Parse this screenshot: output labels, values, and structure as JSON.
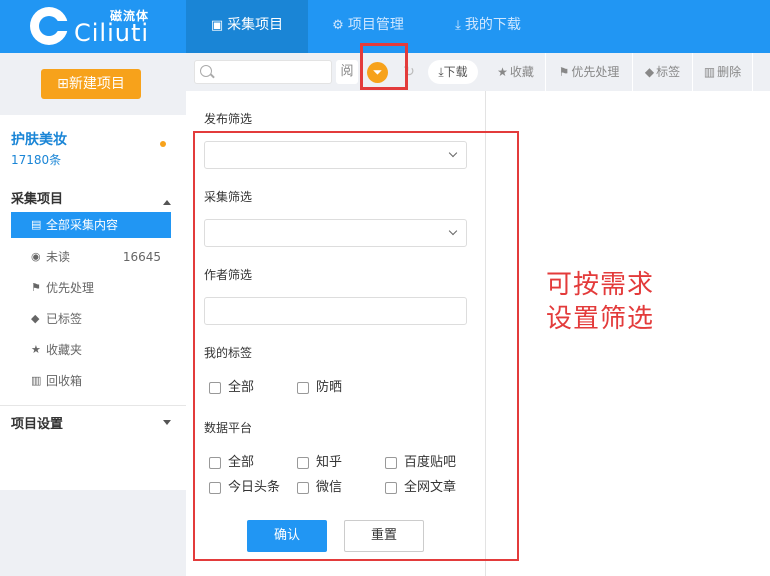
{
  "header": {
    "logo_cn": "磁流体",
    "logo_en": "Ciliuti",
    "tabs": [
      {
        "label": "采集项目",
        "icon": "save-icon",
        "active": true
      },
      {
        "label": "项目管理",
        "icon": "gear-icon",
        "active": false
      },
      {
        "label": "我的下载",
        "icon": "download-icon",
        "active": false
      }
    ],
    "colors": {
      "primary": "#2196f3",
      "active_tab": "#1a85d6",
      "accent": "#f7a21b"
    }
  },
  "sidebar": {
    "new_button": "⊞新建项目",
    "project": {
      "name": "护肤美妆",
      "count": "17180条"
    },
    "section_collect": "采集项目",
    "items": [
      {
        "label": "全部采集内容",
        "icon": "list-icon",
        "active": true,
        "count": ""
      },
      {
        "label": "未读",
        "icon": "eye-icon",
        "active": false,
        "count": "16645"
      },
      {
        "label": "优先处理",
        "icon": "flag-icon",
        "active": false,
        "count": ""
      },
      {
        "label": "已标签",
        "icon": "tag-icon",
        "active": false,
        "count": ""
      },
      {
        "label": "收藏夹",
        "icon": "star-icon",
        "active": false,
        "count": ""
      },
      {
        "label": "回收箱",
        "icon": "trash-icon",
        "active": false,
        "count": ""
      }
    ],
    "section_settings": "项目设置"
  },
  "toolbar": {
    "search_placeholder": "",
    "read_label": "阅",
    "download_label": "下载"
  },
  "right_toolbar": {
    "buttons": [
      {
        "label": "收藏",
        "icon": "star-icon"
      },
      {
        "label": "优先处理",
        "icon": "flag-icon"
      },
      {
        "label": "标签",
        "icon": "tag-icon"
      },
      {
        "label": "删除",
        "icon": "trash-icon"
      }
    ]
  },
  "filter_panel": {
    "publish_label": "发布筛选",
    "publish_value": "",
    "collect_label": "采集筛选",
    "collect_value": "",
    "author_label": "作者筛选",
    "author_value": "",
    "tags_label": "我的标签",
    "tags": [
      "全部",
      "防晒"
    ],
    "platform_label": "数据平台",
    "platforms": [
      "全部",
      "知乎",
      "百度贴吧",
      "今日头条",
      "微信",
      "全网文章"
    ],
    "confirm_label": "确认",
    "reset_label": "重置"
  },
  "annotation": {
    "line1": "可按需求",
    "line2": "设置筛选",
    "color": "#e33b3b"
  }
}
